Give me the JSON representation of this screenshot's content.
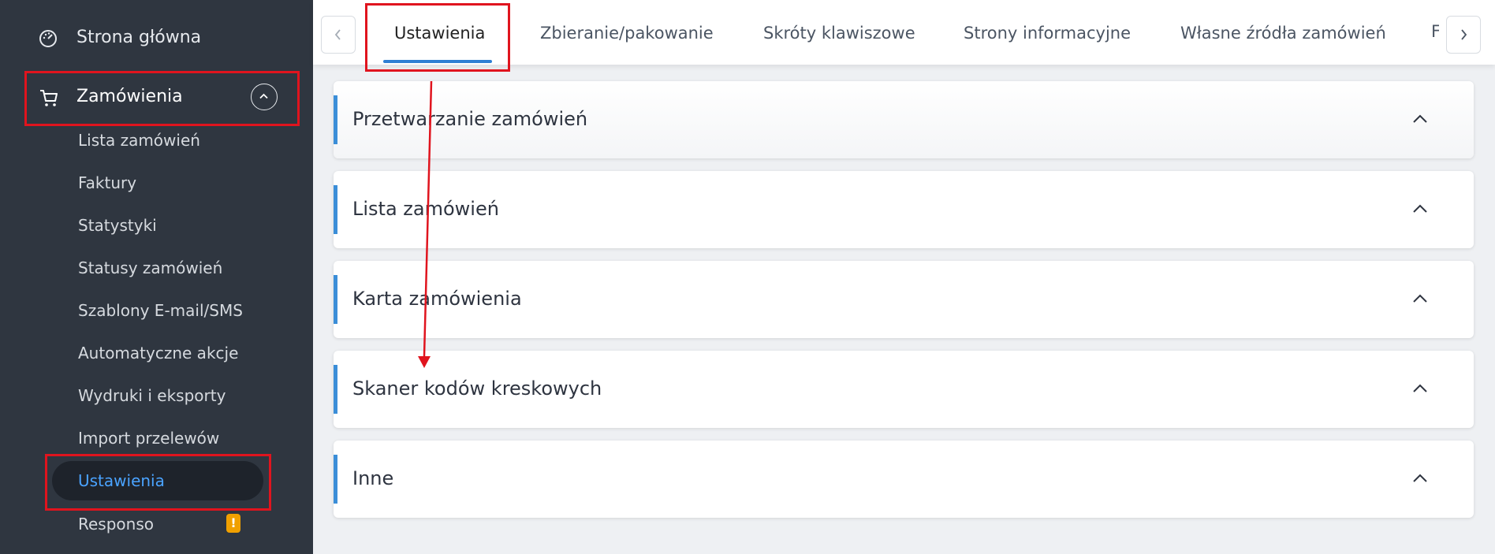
{
  "sidebar": {
    "home_label": "Strona główna",
    "orders_label": "Zamówienia",
    "sub_items": [
      {
        "label": "Lista zamówień"
      },
      {
        "label": "Faktury"
      },
      {
        "label": "Statystyki"
      },
      {
        "label": "Statusy zamówień"
      },
      {
        "label": "Szablony E-mail/SMS"
      },
      {
        "label": "Automatyczne akcje"
      },
      {
        "label": "Wydruki i eksporty"
      },
      {
        "label": "Import przelewów"
      }
    ],
    "active_item_label": "Ustawienia",
    "responso_label": "Responso",
    "badge_text": "!"
  },
  "tabs": {
    "items": [
      {
        "label": "Ustawienia"
      },
      {
        "label": "Zbieranie/pakowanie"
      },
      {
        "label": "Skróty klawiszowe"
      },
      {
        "label": "Strony informacyjne"
      },
      {
        "label": "Własne źródła zamówień"
      },
      {
        "label": "F"
      }
    ],
    "active_index": 0
  },
  "sections": [
    {
      "title": "Przetwarzanie zamówień"
    },
    {
      "title": "Lista zamówień"
    },
    {
      "title": "Karta zamówienia"
    },
    {
      "title": "Skaner kodów kreskowych"
    },
    {
      "title": "Inne"
    }
  ],
  "colors": {
    "sidebar_bg": "#2f3640",
    "accent": "#3b8ed8",
    "highlight": "#e0141e",
    "active_text": "#4aa3ff",
    "badge": "#f0a000"
  }
}
